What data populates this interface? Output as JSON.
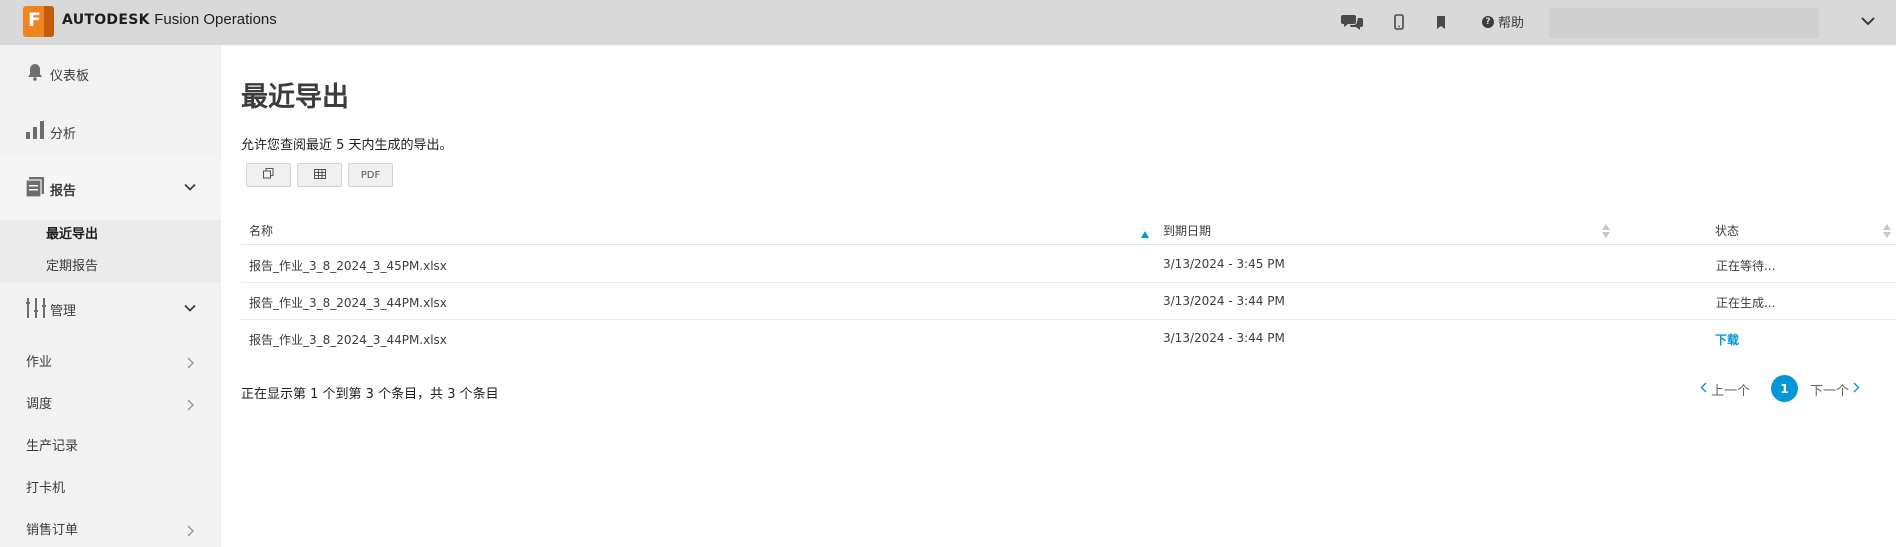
{
  "header": {
    "logo_letter": "F",
    "brand_company": "AUTODESK",
    "brand_product": "Fusion Operations",
    "help_label": "帮助",
    "icons": [
      "chat-icon",
      "mobile-icon",
      "bookmark-icon",
      "help-icon",
      "chevron-down-icon"
    ]
  },
  "sidebar": {
    "dashboard": "仪表板",
    "analysis": "分析",
    "reports": "报告",
    "reports_sub": [
      "最近导出",
      "定期报告"
    ],
    "management": "管理",
    "items": [
      "作业",
      "调度",
      "生产记录",
      "打卡机",
      "销售订单"
    ]
  },
  "main": {
    "title": "最近导出",
    "subtitle": "允许您查阅最近 5 天内生成的导出。",
    "buttons": {
      "copy_icon": "copy-icon",
      "table_icon": "table-icon",
      "pdf": "PDF"
    },
    "columns": [
      "名称",
      "到期日期",
      "状态"
    ],
    "rows": [
      {
        "name": "报告_作业_3_8_2024_3_45PM.xlsx",
        "due": "3/13/2024 - 3:45 PM",
        "status": "正在等待..."
      },
      {
        "name": "报告_作业_3_8_2024_3_44PM.xlsx",
        "due": "3/13/2024 - 3:44 PM",
        "status": "正在生成..."
      },
      {
        "name": "报告_作业_3_8_2024_3_44PM.xlsx",
        "due": "3/13/2024 - 3:44 PM",
        "status": "下载"
      }
    ],
    "info": "正在显示第 1 个到第 3 个条目，共 3 个条目",
    "pager": {
      "prev": "上一个",
      "page": "1",
      "next": "下一个"
    }
  },
  "colors": {
    "accent": "#0696d7",
    "logo": "#f0841e",
    "topbar": "#d9d9d9",
    "sidebar": "#f2f2f2"
  }
}
